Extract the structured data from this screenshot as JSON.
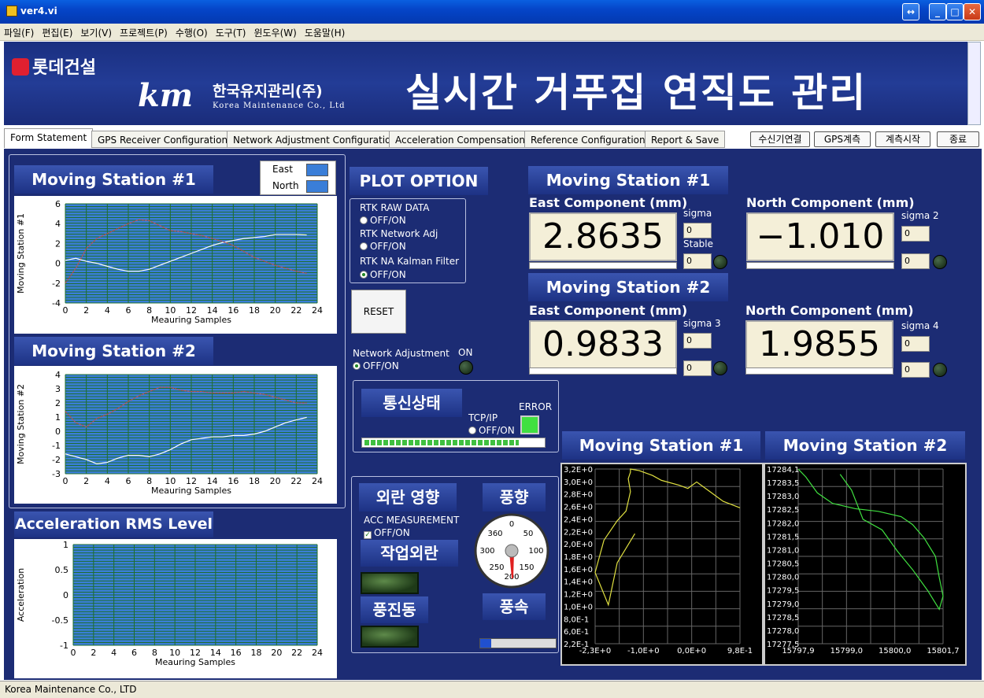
{
  "window": {
    "title": "ver4.vi"
  },
  "menu": [
    "파일(F)",
    "편집(E)",
    "보기(V)",
    "프로젝트(P)",
    "수행(O)",
    "도구(T)",
    "윈도우(W)",
    "도움말(H)"
  ],
  "banner": {
    "company1": "롯데건설",
    "company2": "한국유지관리(주)",
    "company2_en": "Korea Maintenance Co., Ltd",
    "km": "km",
    "title": "실시간 거푸집 연직도 관리"
  },
  "tabs": [
    "Form Statement",
    "GPS Receiver Configuration",
    "Network Adjustment Configuration",
    "Acceleration Compensation",
    "Reference Configuration",
    "Report & Save"
  ],
  "controls": [
    "수신기연결",
    "GPS계측",
    "계측시작",
    "종료"
  ],
  "charts": {
    "ms1": {
      "title": "Moving Station #1",
      "ylabel": "Moving Station #1",
      "xlabel": "Meauring Samples",
      "legend": [
        "East",
        "North"
      ],
      "yticks": [
        "6",
        "4",
        "2",
        "0",
        "-2",
        "-4"
      ],
      "xticks": [
        "0",
        "2",
        "4",
        "6",
        "8",
        "10",
        "12",
        "14",
        "16",
        "18",
        "20",
        "22",
        "24"
      ]
    },
    "ms2": {
      "title": "Moving Station #2",
      "ylabel": "Moving Station #2",
      "xlabel": "Meauring Samples",
      "yticks": [
        "4",
        "3",
        "2",
        "1",
        "0",
        "-1",
        "-2",
        "-3"
      ],
      "xticks": [
        "0",
        "2",
        "4",
        "6",
        "8",
        "10",
        "12",
        "14",
        "16",
        "18",
        "20",
        "22",
        "24"
      ]
    },
    "acc": {
      "title": "Acceleration RMS Level",
      "ylabel": "Acceleration",
      "xlabel": "Meauring Samples",
      "yticks": [
        "1",
        "0.5",
        "0",
        "-0.5",
        "-1"
      ],
      "xticks": [
        "0",
        "2",
        "4",
        "6",
        "8",
        "10",
        "12",
        "14",
        "16",
        "18",
        "20",
        "22",
        "24"
      ]
    }
  },
  "chart_data": [
    {
      "type": "line",
      "title": "Moving Station #1",
      "xlabel": "Meauring Samples",
      "ylabel": "Moving Station #1",
      "xlim": [
        0,
        24
      ],
      "ylim": [
        -4,
        6
      ],
      "series": [
        {
          "name": "East",
          "color": "#ffffff",
          "x": [
            0,
            1,
            2,
            3,
            4,
            5,
            6,
            7,
            8,
            9,
            10,
            11,
            12,
            13,
            14,
            15,
            16,
            17,
            18,
            19,
            20,
            21,
            22,
            23
          ],
          "y": [
            0.3,
            0.5,
            0.2,
            0,
            -0.3,
            -0.6,
            -0.8,
            -0.8,
            -0.6,
            -0.2,
            0.2,
            0.6,
            1,
            1.4,
            1.8,
            2.1,
            2.3,
            2.5,
            2.6,
            2.7,
            2.9,
            2.9,
            2.9,
            2.86
          ]
        },
        {
          "name": "North",
          "color": "#c0504d",
          "x": [
            0,
            1,
            2,
            3,
            4,
            5,
            6,
            7,
            8,
            9,
            10,
            11,
            12,
            13,
            14,
            15,
            16,
            17,
            18,
            19,
            20,
            21,
            22,
            23
          ],
          "y": [
            -2,
            -0.5,
            1.5,
            2.5,
            3,
            3.5,
            4,
            4.4,
            4.3,
            3.8,
            3.3,
            3.2,
            3,
            2.8,
            2.5,
            2.2,
            1.8,
            1.2,
            0.6,
            0.2,
            -0.2,
            -0.5,
            -0.8,
            -1.01
          ]
        }
      ]
    },
    {
      "type": "line",
      "title": "Moving Station #2",
      "xlabel": "Meauring Samples",
      "ylabel": "Moving Station #2",
      "xlim": [
        0,
        24
      ],
      "ylim": [
        -3,
        4
      ],
      "series": [
        {
          "name": "East",
          "color": "#ffffff",
          "x": [
            0,
            1,
            2,
            3,
            4,
            5,
            6,
            7,
            8,
            9,
            10,
            11,
            12,
            13,
            14,
            15,
            16,
            17,
            18,
            19,
            20,
            21,
            22,
            23
          ],
          "y": [
            -1.6,
            -1.8,
            -2,
            -2.3,
            -2.2,
            -1.9,
            -1.7,
            -1.7,
            -1.8,
            -1.6,
            -1.3,
            -0.9,
            -0.6,
            -0.5,
            -0.4,
            -0.4,
            -0.3,
            -0.3,
            -0.2,
            0,
            0.3,
            0.6,
            0.8,
            0.98
          ]
        },
        {
          "name": "North",
          "color": "#c0504d",
          "x": [
            0,
            1,
            2,
            3,
            4,
            5,
            6,
            7,
            8,
            9,
            10,
            11,
            12,
            13,
            14,
            15,
            16,
            17,
            18,
            19,
            20,
            21,
            22,
            23
          ],
          "y": [
            1.4,
            0.6,
            0.3,
            0.9,
            1.2,
            1.6,
            2.1,
            2.5,
            2.8,
            3.1,
            3.1,
            2.9,
            2.8,
            2.8,
            2.7,
            2.7,
            2.7,
            2.8,
            2.7,
            2.6,
            2.4,
            2.2,
            2,
            1.99
          ]
        }
      ]
    },
    {
      "type": "line",
      "title": "Acceleration RMS Level",
      "xlabel": "Meauring Samples",
      "ylabel": "Acceleration",
      "xlim": [
        0,
        24
      ],
      "ylim": [
        -1,
        1
      ],
      "series": []
    },
    {
      "type": "scatter",
      "title": "Moving Station #1",
      "xlim": [
        -2.3,
        0.98
      ],
      "ylim": [
        -2.2,
        3.2
      ],
      "series": [
        {
          "color": "#e0e040",
          "x": [
            -1.4,
            -1.8,
            -2.0,
            -2.3,
            -2.1,
            -1.8,
            -1.6,
            -1.5,
            -1.55,
            -1.5,
            -1.5,
            -1.3,
            -1.0,
            -0.8,
            -0.4,
            -0.2,
            0.0,
            0.3,
            0.6,
            0.98
          ],
          "y": [
            1.2,
            0.3,
            -1.0,
            0.0,
            1.0,
            1.6,
            1.9,
            2.5,
            2.9,
            3.1,
            3.2,
            3.15,
            3.0,
            2.85,
            2.7,
            2.6,
            2.8,
            2.5,
            2.2,
            2.0
          ]
        }
      ]
    },
    {
      "type": "scatter",
      "title": "Moving Station #2",
      "xlim": [
        15797.9,
        15801.7
      ],
      "ylim": [
        17277.5,
        17284.1
      ],
      "series": [
        {
          "color": "#40e040",
          "x": [
            15797.9,
            15798.1,
            15798.4,
            15798.8,
            15799.4,
            15800.0,
            15800.6,
            15800.9,
            15801.2,
            15801.5,
            15801.6,
            15801.7,
            15801.6,
            15801.3,
            15800.9,
            15800.5,
            15800.1,
            15799.6,
            15799.3,
            15799.0
          ],
          "y": [
            17284.1,
            17283.8,
            17283.2,
            17282.8,
            17282.6,
            17282.5,
            17282.3,
            17282.0,
            17281.5,
            17280.8,
            17280.0,
            17279.3,
            17278.8,
            17279.5,
            17280.3,
            17281.0,
            17281.8,
            17282.2,
            17283.3,
            17283.9
          ]
        }
      ]
    }
  ],
  "plot": {
    "title": "PLOT OPTION",
    "opt1": "RTK RAW DATA",
    "opt2": "RTK Network Adj",
    "opt3": "RTK NA Kalman Filter",
    "offon": "OFF/ON",
    "reset": "RESET",
    "netadj": "Network Adjustment",
    "on": "ON"
  },
  "comm": {
    "title": "통신상태",
    "tcp": "TCP/IP",
    "offon": "OFF/ON",
    "error": "ERROR"
  },
  "disturb": {
    "title": "외란 영향",
    "acc": "ACC MEASUREMENT",
    "offon": "OFF/ON",
    "work": "작업외란",
    "vib": "풍진동",
    "wind_dir": "풍향",
    "wind_speed": "풍속",
    "dial": [
      "0",
      "50",
      "100",
      "150",
      "200",
      "250",
      "300",
      "360"
    ]
  },
  "ms1": {
    "title": "Moving Station #1",
    "east_label": "East Component (mm)",
    "north_label": "North Component (mm)",
    "east": "2.8635",
    "north": "−1.010",
    "sigma": "sigma",
    "sigma2": "sigma 2",
    "stable": "Stable",
    "s0": "0"
  },
  "ms2": {
    "title": "Moving Station #2",
    "east_label": "East Component (mm)",
    "north_label": "North Component (mm)",
    "east": "0.9833",
    "north": "1.9855",
    "sigma3": "sigma 3",
    "sigma4": "sigma 4",
    "s0": "0"
  },
  "xy1": {
    "title": "Moving Station #1",
    "yticks": [
      "3,2E+0",
      "3,0E+0",
      "2,8E+0",
      "2,6E+0",
      "2,4E+0",
      "2,2E+0",
      "2,0E+0",
      "1,8E+0",
      "1,6E+0",
      "1,4E+0",
      "1,2E+0",
      "1,0E+0",
      "8,0E-1",
      "6,0E-1",
      "2,2E-1"
    ],
    "xticks": [
      "-2,3E+0",
      "-1,0E+0",
      "0,0E+0",
      "9,8E-1"
    ]
  },
  "xy2": {
    "title": "Moving Station #2",
    "yticks": [
      "17284,1",
      "17283,5",
      "17283,0",
      "17282,5",
      "17282,0",
      "17281,5",
      "17281,0",
      "17280,5",
      "17280,0",
      "17279,5",
      "17279,0",
      "17278,5",
      "17278,0",
      "17277,5"
    ],
    "xticks": [
      "15797,9",
      "15799,0",
      "15800,0",
      "15801,7"
    ]
  },
  "statusbar": "Korea Maintenance Co., LTD",
  "colors": {
    "panel": "#1c2c74",
    "plot": "#3a7ed8",
    "grid": "#1e6e2e"
  }
}
